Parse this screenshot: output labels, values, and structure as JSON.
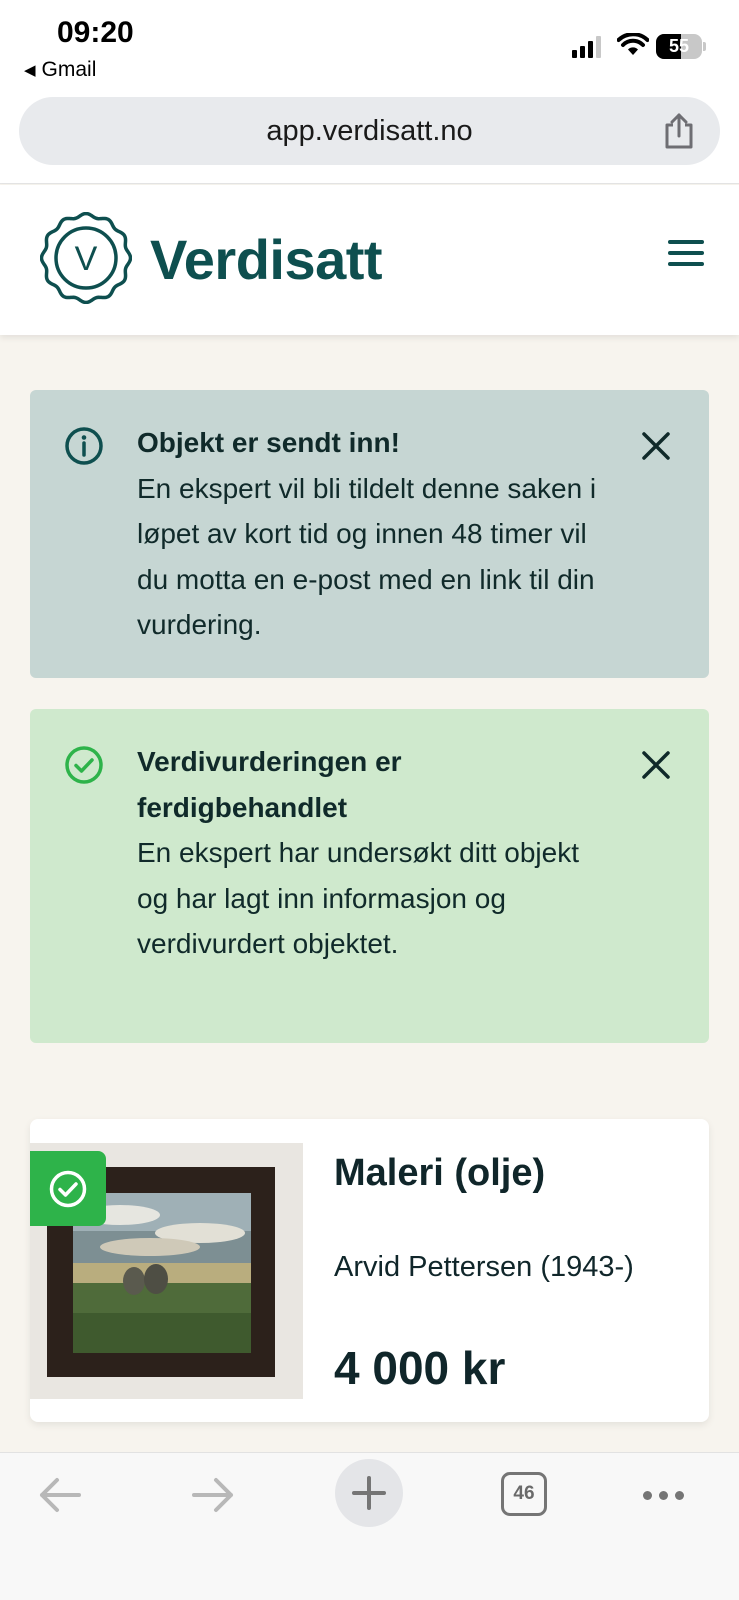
{
  "status_bar": {
    "time": "09:20",
    "back_app": "Gmail",
    "battery": "55",
    "battery_level": 0.55,
    "signal_bars": 3
  },
  "browser": {
    "url": "app.verdisatt.no",
    "tab_count": "46"
  },
  "header": {
    "logo_letter": "V",
    "brand": "Verdisatt"
  },
  "alerts": [
    {
      "type": "info",
      "title": "Objekt er sendt inn!",
      "message": "En ekspert vil bli tildelt denne saken i løpet av kort tid og innen 48 timer vil du motta en e-post med en link til din vurdering."
    },
    {
      "type": "success",
      "title": "Verdivurderingen er ferdigbehandlet",
      "message": "En ekspert har undersøkt ditt objekt og har lagt inn informasjon og verdivurdert objektet."
    }
  ],
  "card": {
    "title": "Maleri (olje)",
    "artist": "Arvid Pettersen (1943-)",
    "price": "4 000 kr"
  },
  "colors": {
    "brand": "#0e4f4f",
    "info_bg": "#c6d6d3",
    "success_bg": "#cfe9cd",
    "success_accent": "#2eb34a"
  }
}
